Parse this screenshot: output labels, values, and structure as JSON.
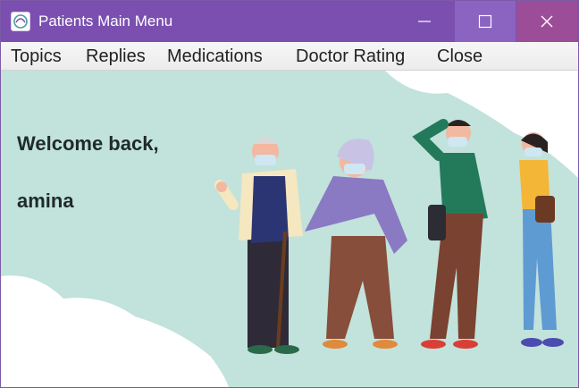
{
  "window": {
    "title": "Patients Main Menu",
    "accent_color": "#7a4fb0",
    "controls": [
      "minimize-icon",
      "maximize-icon",
      "close-icon"
    ]
  },
  "menu": {
    "items": [
      "Topics",
      "Replies",
      "Medications",
      "Doctor Rating",
      "Close"
    ]
  },
  "content": {
    "welcome_line": "Welcome back,",
    "username": "amina",
    "background_color": "#c2e2dc",
    "illustration": "people-wearing-masks-illustration"
  }
}
